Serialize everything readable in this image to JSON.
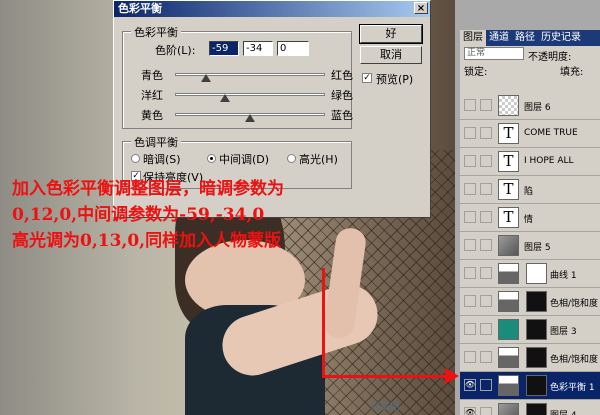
{
  "dialog": {
    "title": "色彩平衡",
    "close_glyph": "×",
    "balance_group_title": "色彩平衡",
    "levels_label": "色阶(L):",
    "levels_values": [
      "-59",
      "-34",
      "0"
    ],
    "sliders": [
      {
        "left": "青色",
        "right": "红色",
        "value": -59
      },
      {
        "left": "洋红",
        "right": "绿色",
        "value": -34
      },
      {
        "left": "黄色",
        "right": "蓝色",
        "value": 0
      }
    ],
    "tone_group_title": "色调平衡",
    "tones": [
      {
        "label": "暗调(S)",
        "selected": false
      },
      {
        "label": "中间调(D)",
        "selected": true
      },
      {
        "label": "高光(H)",
        "selected": false
      }
    ],
    "preserve_luminosity_label": "保持亮度(V)",
    "preserve_luminosity_checked": true,
    "ok_label": "好",
    "cancel_label": "取消",
    "preview_label": "预览(P)",
    "preview_checked": true,
    "check_glyph": "✓"
  },
  "annotation": {
    "line1": "加入色彩平衡调整图层，暗调参数为",
    "line2": "0,12,0,中间调参数为-59,-34,0",
    "line3": "高光调为0,13,0,同样加入人物蒙版"
  },
  "watermark": "寂寞斯",
  "layers_panel": {
    "tabs": [
      {
        "label": "图层",
        "active": true
      },
      {
        "label": "通道",
        "active": false
      },
      {
        "label": "路径",
        "active": false
      },
      {
        "label": "历史记录",
        "active": false
      }
    ],
    "blend_mode": "正常",
    "opacity_label": "不透明度:",
    "lock_label": "锁定:",
    "fill_label": "填充:",
    "eye_glyph": "👁",
    "layers": [
      {
        "name": "图层 6",
        "thumb": "check-bg",
        "mask": null,
        "selected": false,
        "visible": false
      },
      {
        "name": "COME TRUE",
        "thumb": "type",
        "thumb_glyph": "T",
        "mask": null,
        "selected": false,
        "visible": false
      },
      {
        "name": "I HOPE ALL",
        "thumb": "type",
        "thumb_glyph": "T",
        "mask": null,
        "selected": false,
        "visible": false
      },
      {
        "name": "陷",
        "thumb": "type",
        "thumb_glyph": "T",
        "mask": null,
        "selected": false,
        "visible": false
      },
      {
        "name": "情",
        "thumb": "type",
        "thumb_glyph": "T",
        "mask": null,
        "selected": false,
        "visible": false
      },
      {
        "name": "图层 5",
        "thumb": "photo",
        "mask": null,
        "selected": false,
        "visible": false
      },
      {
        "name": "曲线 1",
        "thumb": "adj",
        "mask": "white",
        "selected": false,
        "visible": false
      },
      {
        "name": "色相/饱和度",
        "thumb": "adj",
        "mask": "dark",
        "selected": false,
        "visible": false
      },
      {
        "name": "图层 3",
        "thumb": "teal",
        "mask": "dark",
        "selected": false,
        "visible": false
      },
      {
        "name": "色相/饱和度",
        "thumb": "adj",
        "mask": "dark",
        "selected": false,
        "visible": false
      },
      {
        "name": "色彩平衡 1",
        "thumb": "adj",
        "mask": "dark",
        "selected": true,
        "visible": true
      },
      {
        "name": "图层 4",
        "thumb": "photo",
        "mask": "dark",
        "selected": false,
        "visible": true
      }
    ]
  }
}
